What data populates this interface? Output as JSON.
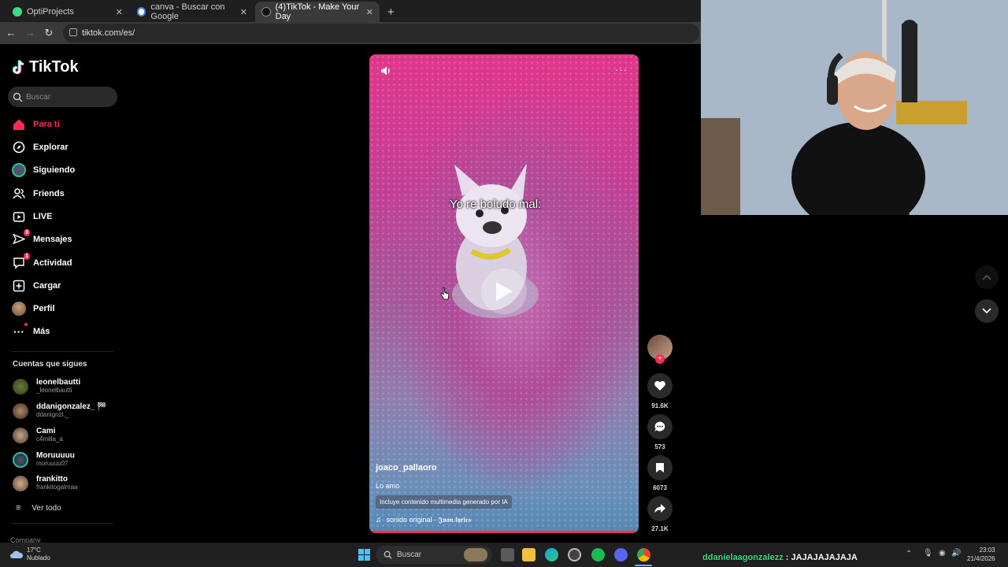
{
  "browser": {
    "tabs": [
      {
        "title": "OptiProjects",
        "active": false,
        "fav_color": "#3ddc84"
      },
      {
        "title": "canva - Buscar con Google",
        "active": false,
        "fav_color": "#4285f4"
      },
      {
        "title": "(4)TikTok - Make Your Day",
        "active": true,
        "fav_color": "#111111"
      }
    ],
    "url": "tiktok.com/es/"
  },
  "sidebar": {
    "logo": "TikTok",
    "search_placeholder": "Buscar",
    "nav": [
      {
        "label": "Para ti",
        "icon": "home-icon",
        "active": true
      },
      {
        "label": "Explorar",
        "icon": "compass-icon"
      },
      {
        "label": "Siguiendo",
        "icon": "following-avatar-icon"
      },
      {
        "label": "Friends",
        "icon": "friends-icon"
      },
      {
        "label": "LIVE",
        "icon": "live-icon"
      },
      {
        "label": "Mensajes",
        "icon": "paper-plane-icon",
        "badge": "3"
      },
      {
        "label": "Actividad",
        "icon": "activity-icon",
        "badge": "1"
      },
      {
        "label": "Cargar",
        "icon": "upload-icon"
      },
      {
        "label": "Perfil",
        "icon": "profile-avatar-icon"
      },
      {
        "label": "Más",
        "icon": "more-icon"
      }
    ],
    "following_title": "Cuentas que sigues",
    "following": [
      {
        "name": "leonelbautti",
        "handle": "_leonelbautti"
      },
      {
        "name": "ddanigonzalez_ 🏁",
        "handle": "ddanignzl._"
      },
      {
        "name": "Cami",
        "handle": "c4milla_a"
      },
      {
        "name": "Moruuuuu",
        "handle": "moruuuu07"
      },
      {
        "name": "frankitto",
        "handle": "frankitogalmaa"
      }
    ],
    "see_all": "Ver todo",
    "company": "Company"
  },
  "video": {
    "caption": "Yo re boludo mal:",
    "author": "joaco_pallaoro",
    "description": "Lo amo",
    "ai_label": "Incluye contenido multimedia generado por IA",
    "sound": "sonido original - 𝕵𝖚𝖆𝖓.𝖑𝖞𝖗𝖎𝖈𝖘",
    "progress": 0.99
  },
  "actions": {
    "likes": "91.6K",
    "comments": "573",
    "saves": "6073",
    "shares": "27.1K"
  },
  "taskbar": {
    "weather_temp": "17°C",
    "weather_desc": "Nublado",
    "search": "Buscar",
    "time": "23:03",
    "date": "21/4/2026"
  },
  "chat_overlay": {
    "user": "ddanielaagonzalezz",
    "message": " : JAJAJAJAJAJA"
  },
  "colors": {
    "accent": "#fe2c55",
    "chat_user": "#3ddc84"
  }
}
